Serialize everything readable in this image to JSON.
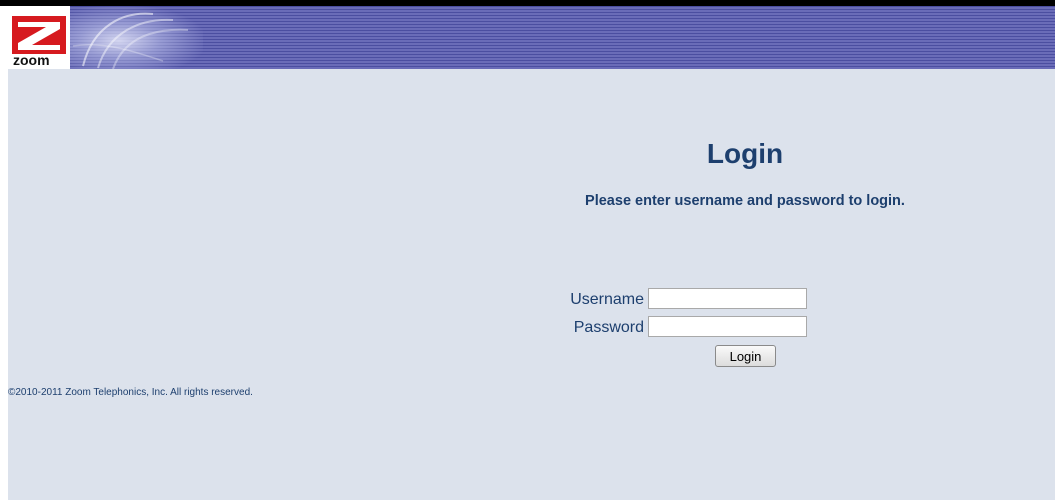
{
  "header": {
    "logo_text": "zoom"
  },
  "login": {
    "title": "Login",
    "instructions": "Please enter username and password to login.",
    "username_label": "Username",
    "password_label": "Password",
    "username_value": "",
    "password_value": "",
    "submit_label": "Login"
  },
  "footer": {
    "copyright": "©2010-2011 Zoom Telephonics, Inc. All rights reserved."
  },
  "colors": {
    "background": "#dce2ec",
    "header_band": "#5f61b0",
    "text": "#1d3f6e",
    "logo_red": "#d61a1f"
  }
}
